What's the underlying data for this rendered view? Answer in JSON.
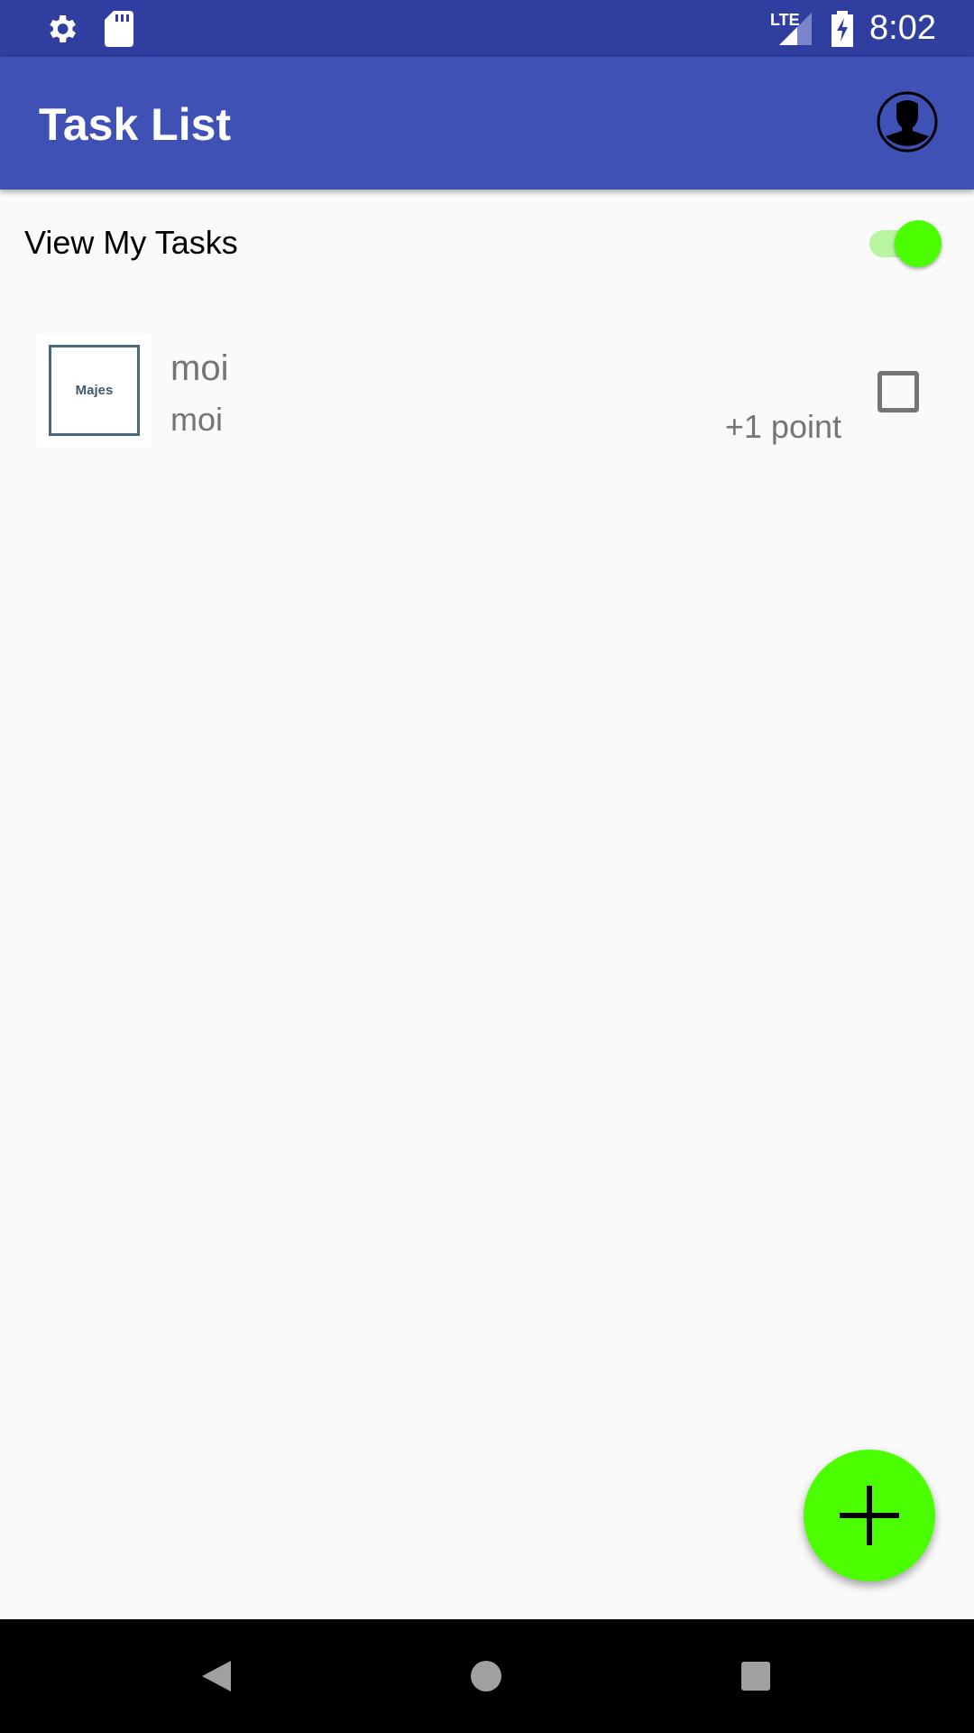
{
  "status_bar": {
    "time": "8:02",
    "network": "LTE",
    "icons": [
      "settings-icon",
      "sd-card-icon",
      "signal-icon",
      "battery-charging-icon"
    ]
  },
  "toolbar": {
    "title": "Task List",
    "avatar_icon": "account-circle-icon"
  },
  "filter": {
    "label": "View My Tasks",
    "enabled": true,
    "accent": "#4cff00"
  },
  "tasks": [
    {
      "title": "moi",
      "subtitle": "moi",
      "points": "+1 point",
      "thumbnail_text": "Majes",
      "checked": false
    }
  ],
  "fab": {
    "icon": "plus-icon",
    "color": "#4cff00"
  },
  "colors": {
    "primary": "#3f51b5",
    "primary_dark": "#303f9f"
  }
}
